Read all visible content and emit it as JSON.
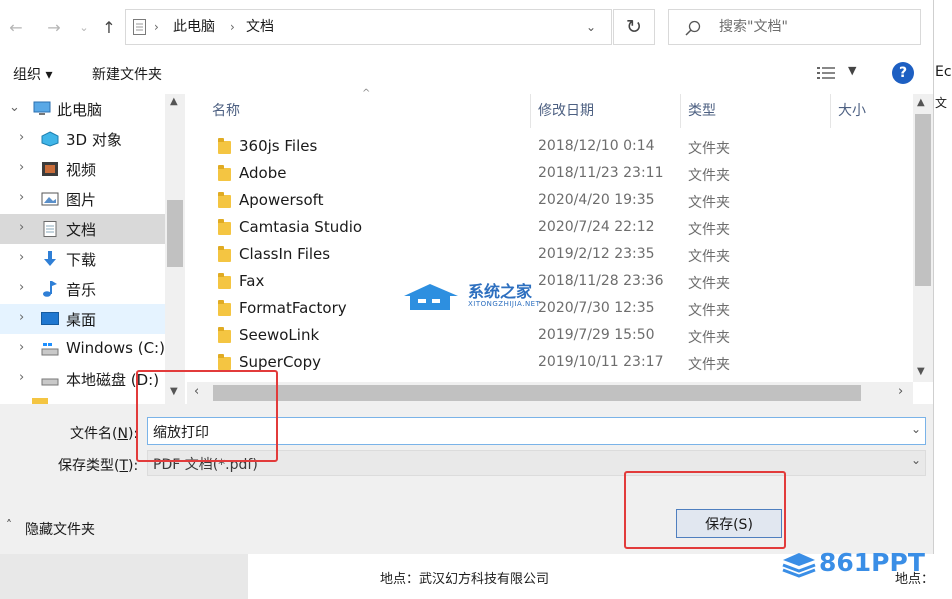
{
  "address": {
    "crumbs": [
      "此电脑",
      "文档"
    ]
  },
  "search": {
    "placeholder": "搜索\"文档\""
  },
  "toolbar": {
    "organize": "组织 ▾",
    "new_folder": "新建文件夹"
  },
  "nav": {
    "items": [
      {
        "label": "此电脑",
        "icon": "computer-icon"
      },
      {
        "label": "3D 对象",
        "icon": "3d-objects-icon"
      },
      {
        "label": "视频",
        "icon": "video-icon"
      },
      {
        "label": "图片",
        "icon": "pictures-icon"
      },
      {
        "label": "文档",
        "icon": "documents-icon"
      },
      {
        "label": "下载",
        "icon": "download-icon"
      },
      {
        "label": "音乐",
        "icon": "music-icon"
      },
      {
        "label": "桌面",
        "icon": "desktop-icon"
      },
      {
        "label": "Windows (C:)",
        "icon": "drive-icon"
      },
      {
        "label": "本地磁盘 (D:)",
        "icon": "drive-icon"
      }
    ]
  },
  "columns": {
    "name": "名称",
    "date": "修改日期",
    "type": "类型",
    "size": "大小"
  },
  "files": [
    {
      "name": "360js Files",
      "date": "2018/12/10 0:14",
      "type": "文件夹"
    },
    {
      "name": "Adobe",
      "date": "2018/11/23 23:11",
      "type": "文件夹"
    },
    {
      "name": "Apowersoft",
      "date": "2020/4/20 19:35",
      "type": "文件夹"
    },
    {
      "name": "Camtasia Studio",
      "date": "2020/7/24 22:12",
      "type": "文件夹"
    },
    {
      "name": "ClassIn Files",
      "date": "2019/2/12 23:35",
      "type": "文件夹"
    },
    {
      "name": "Fax",
      "date": "2018/11/28 23:36",
      "type": "文件夹"
    },
    {
      "name": "FormatFactory",
      "date": "2020/7/30 12:35",
      "type": "文件夹"
    },
    {
      "name": "SeewoLink",
      "date": "2019/7/29 15:50",
      "type": "文件夹"
    },
    {
      "name": "SuperCopy",
      "date": "2019/10/11 23:17",
      "type": "文件夹"
    }
  ],
  "form": {
    "filename_label_pre": "文件名(",
    "filename_label_key": "N",
    "filename_label_post": "):",
    "filename_value": "缩放打印",
    "filetype_label_pre": "保存类型(",
    "filetype_label_key": "T",
    "filetype_label_post": "):",
    "filetype_value": "PDF 文档(*.pdf)",
    "hide_folders": "隐藏文件夹",
    "save_button": "保存(S)"
  },
  "background": {
    "address_text": "地点：武汉幻方科技有限公司",
    "address_text_right": "地点：",
    "edge_text_1": "EcD",
    "edge_text_2": "文"
  },
  "watermarks": {
    "center_cn": "系统之家",
    "center_en": "XITONGZHIJIA.NET",
    "corner": "861PPT"
  }
}
